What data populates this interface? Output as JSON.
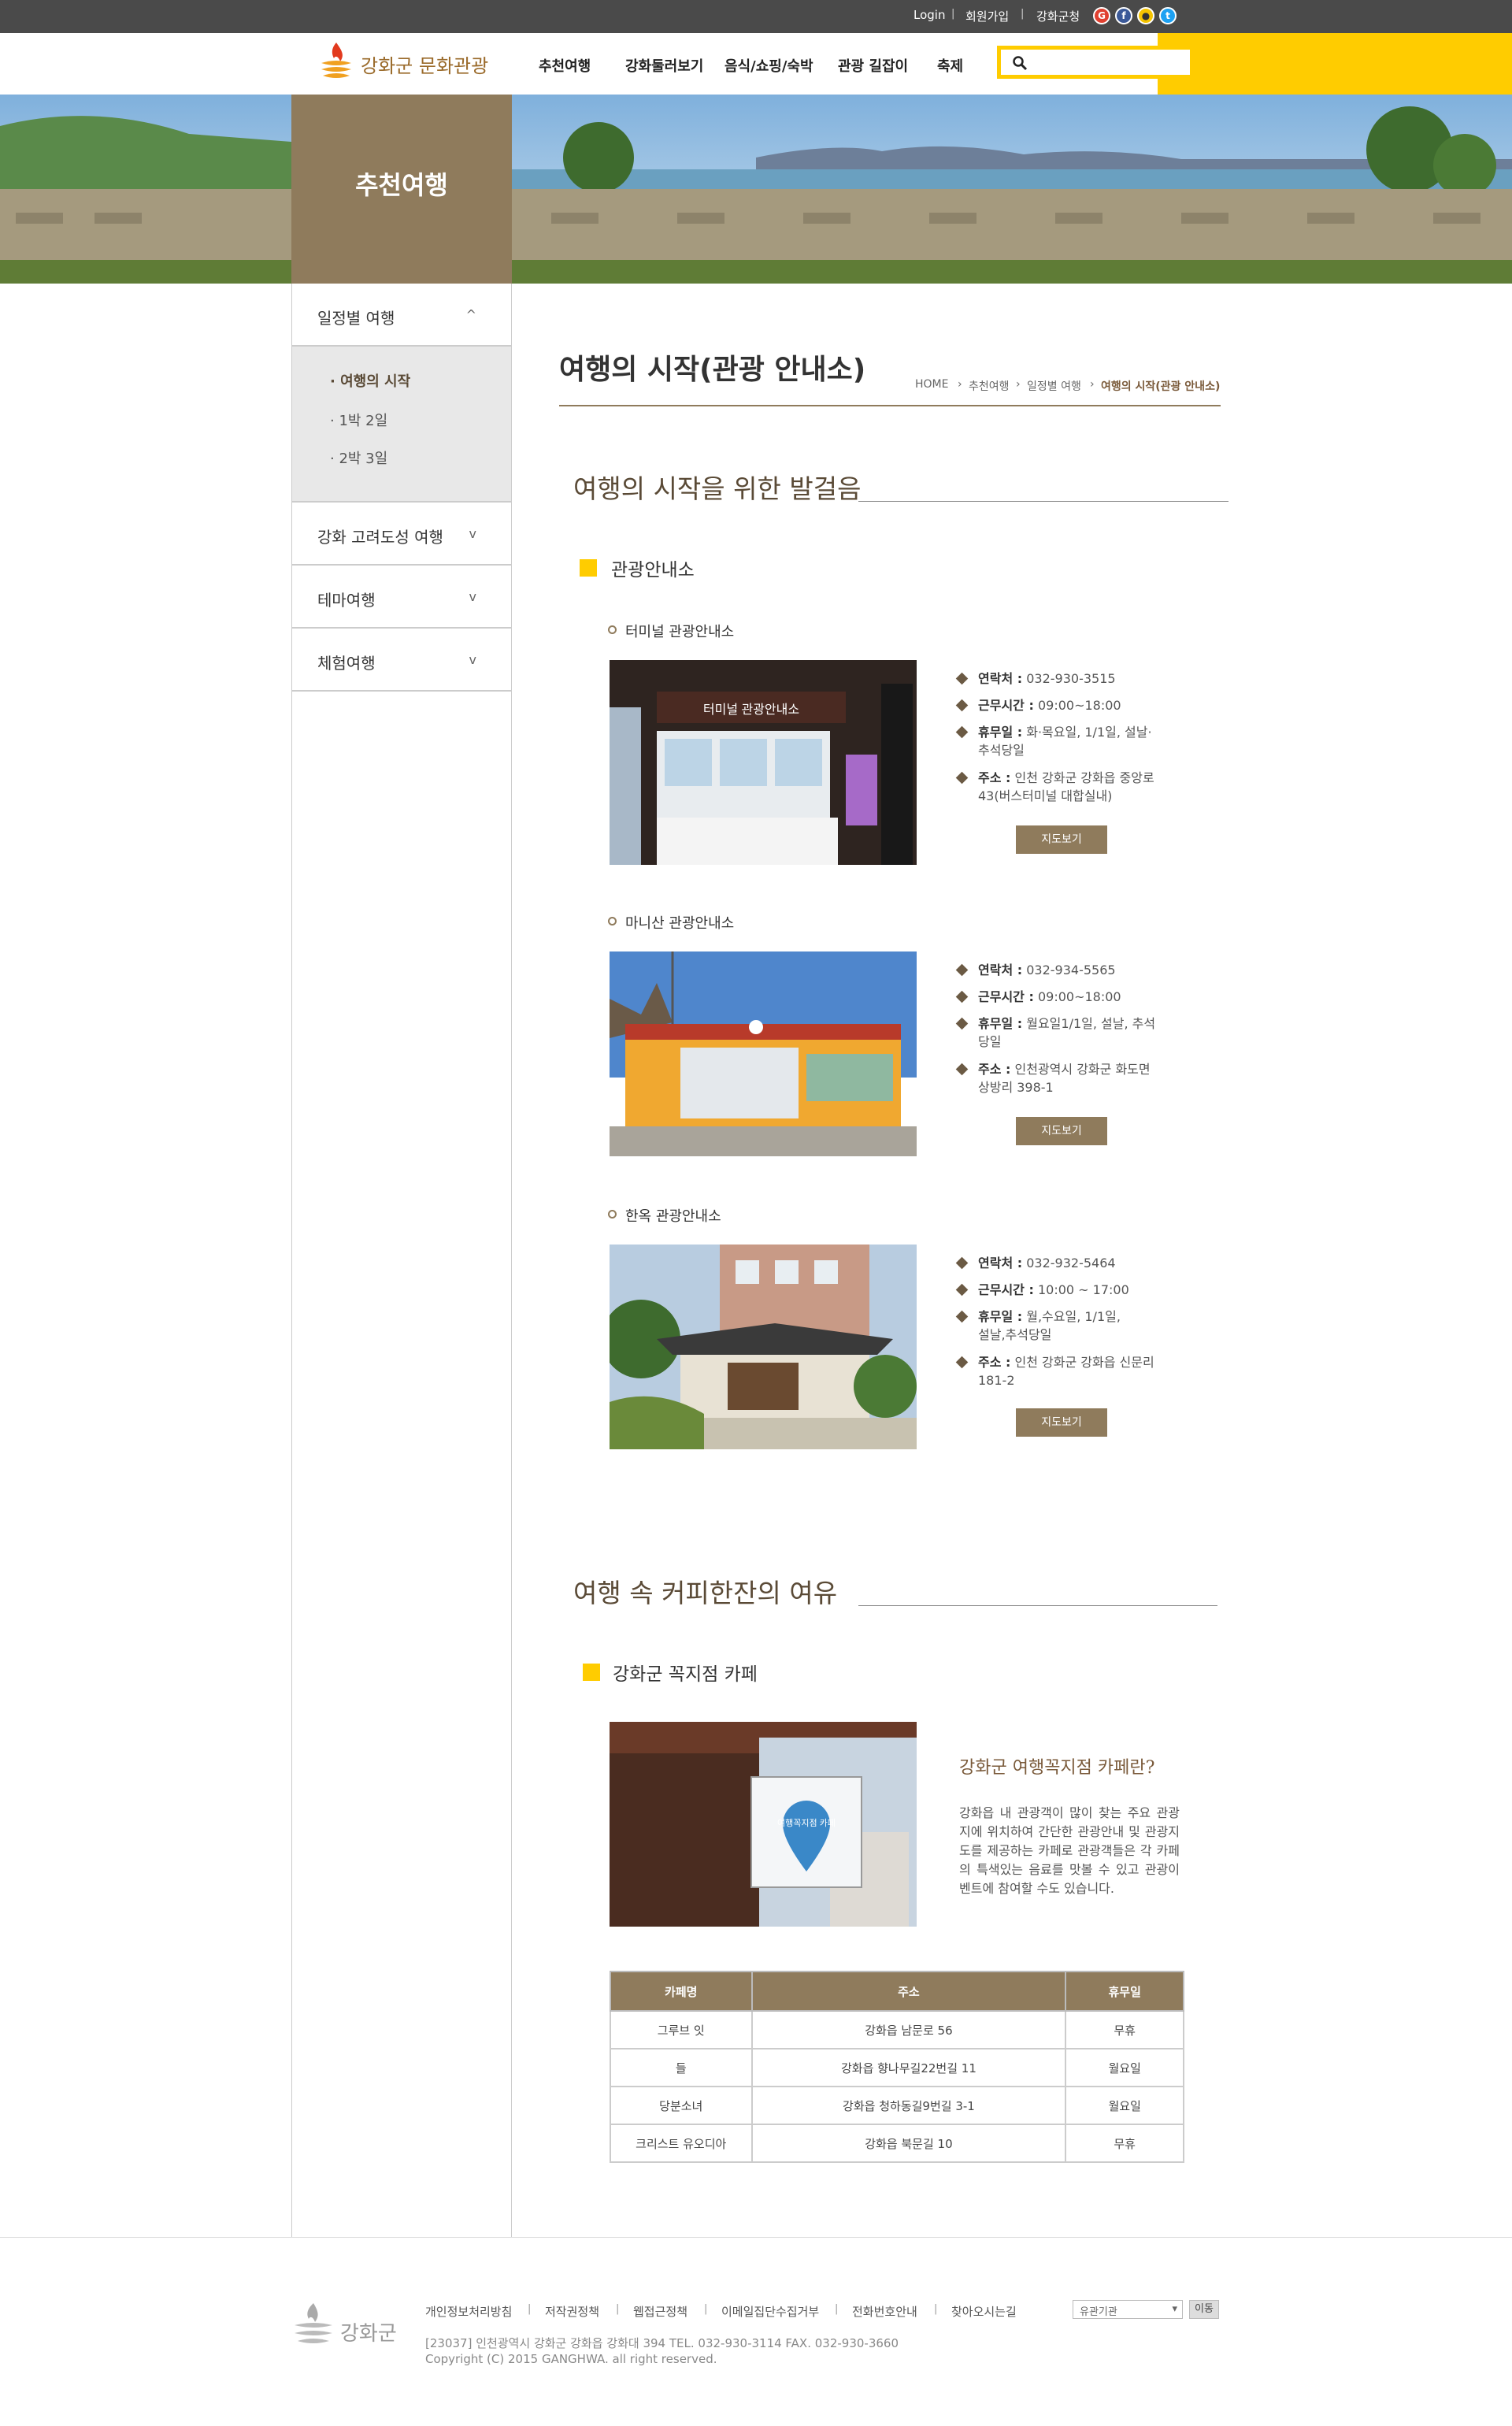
{
  "topbar": {
    "login": "Login",
    "join": "회원가입",
    "county": "강화군청"
  },
  "header": {
    "logo_text": "강화군 문화관광",
    "nav": [
      "추천여행",
      "강화둘러보기",
      "음식/쇼핑/숙박",
      "관광 길잡이",
      "축제"
    ],
    "search_placeholder": ""
  },
  "hero": {
    "title": "추천여행"
  },
  "sidebar": {
    "menus": [
      {
        "label": "일정별 여행",
        "chevron": "^"
      },
      {
        "label": "강화 고려도성 여행",
        "chevron": "v"
      },
      {
        "label": "테마여행",
        "chevron": "v"
      },
      {
        "label": "체험여행",
        "chevron": "v"
      }
    ],
    "sub": [
      "· 여행의 시작",
      "· 1박 2일",
      "· 2박 3일"
    ]
  },
  "main": {
    "title": "여행의 시작(관광 안내소)",
    "breadcrumb": [
      "HOME",
      "추천여행",
      "일정별 여행",
      "여행의 시작(관광 안내소)"
    ],
    "section1": {
      "title": "여행의 시작을 위한 발걸음",
      "heading": "관광안내소",
      "centers": [
        {
          "name": "터미널 관광안내소",
          "phone_label": "연락처 :",
          "phone": "032-930-3515",
          "hours_label": "근무시간 :",
          "hours": "09:00~18:00",
          "closed_label": "휴무일 :",
          "closed": "화·목요일, 1/1일, 설날·\n추석당일",
          "addr_label": "주소 :",
          "addr": "인천 강화군 강화읍 중앙로\n43(버스터미널 대합실내)",
          "button": "지도보기"
        },
        {
          "name": "마니산 관광안내소",
          "phone_label": "연락처 :",
          "phone": "032-934-5565",
          "hours_label": "근무시간 :",
          "hours": "09:00~18:00",
          "closed_label": "휴무일 :",
          "closed": "월요일1/1일, 설날, 추석\n당일",
          "addr_label": "주소 :",
          "addr": "인천광역시 강화군 화도면\n상방리 398-1",
          "button": "지도보기"
        },
        {
          "name": "한옥 관광안내소",
          "phone_label": "연락처 :",
          "phone": "032-932-5464",
          "hours_label": "근무시간 :",
          "hours": "10:00 ~ 17:00",
          "closed_label": "휴무일 :",
          "closed": "월,수요일, 1/1일,\n설날,추석당일",
          "addr_label": "주소 :",
          "addr": "인천 강화군 강화읍 신문리\n181-2",
          "button": "지도보기"
        }
      ]
    },
    "section2": {
      "title": "여행 속 커피한잔의 여유",
      "heading": "강화군 꼭지점 카페",
      "sign_text": "여행꼭지점 카페",
      "question": "강화군 여행꼭지점 카페란?",
      "description": "강화읍 내 관광객이 많이 찾는 주요 관광지에 위치하여 간단한 관광안내 및 관광지도를 제공하는 카페로 관광객들은 각 카페의 특색있는 음료를 맛볼 수 있고 관광이벤트에 참여할 수도 있습니다.",
      "table": {
        "headers": [
          "카페명",
          "주소",
          "휴무일"
        ],
        "rows": [
          [
            "그루브 잇",
            "강화읍 남문로 56",
            "무휴"
          ],
          [
            "들",
            "강화읍 향나무길22번길 11",
            "월요일"
          ],
          [
            "당분소녀",
            "강화읍 청하동길9번길 3-1",
            "월요일"
          ],
          [
            "크리스트 유오디아",
            "강화읍 북문길 10",
            "무휴"
          ]
        ]
      }
    }
  },
  "footer": {
    "logo_text": "강화군",
    "links": [
      "개인정보처리방침",
      "저작권정책",
      "웹접근정책",
      "이메일집단수집거부",
      "전화번호안내",
      "찾아오시는길"
    ],
    "select_label": "유관기관",
    "go_button": "이동",
    "address": "[23037] 인천광역시 강화군 강화읍 강화대 394 TEL. 032-930-3114 FAX. 032-930-3660",
    "copyright": "Copyright (C) 2015 GANGHWA. all right reserved."
  },
  "colors": {
    "accent_yellow": "#ffcc00",
    "brown": "#8f7b5c",
    "topbar": "#4a4a4a"
  }
}
